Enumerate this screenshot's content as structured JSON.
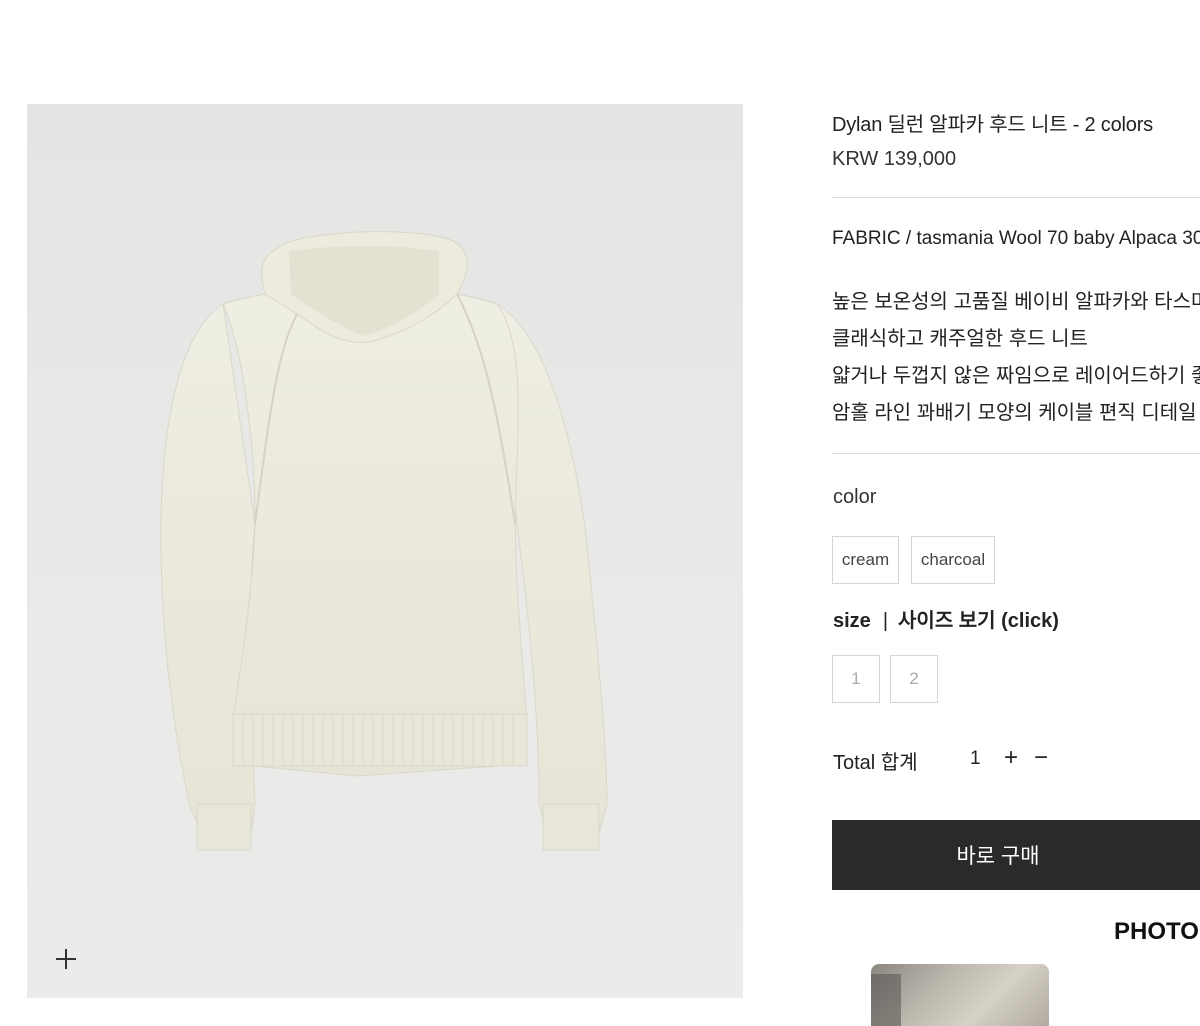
{
  "product": {
    "title": "Dylan 딜런 알파카 후드 니트 - 2 colors",
    "price": "KRW 139,000",
    "fabric": "FABRIC / tasmania Wool 70 baby Alpaca 30",
    "description": [
      "높은 보온성의 고품질 베이비 알파카와 타스마니아 울",
      "클래식하고 캐주얼한 후드 니트",
      "얇거나 두껍지 않은 짜임으로 레이어드하기 좋은",
      "암홀 라인 꽈배기 모양의 케이블 편직 디테일"
    ],
    "image_icon": "zoom-plus-icon"
  },
  "options": {
    "color_label": "color",
    "colors": [
      "cream",
      "charcoal"
    ],
    "size_label": "size",
    "size_separator": "|",
    "size_guide_link": "사이즈 보기 (click)",
    "sizes": [
      "1",
      "2"
    ]
  },
  "quantity": {
    "label": "Total 합계",
    "value": "1",
    "plus": "+",
    "minus": "−"
  },
  "buy_button": "바로 구매",
  "reviews": {
    "heading": "PHOTO"
  },
  "colors": {
    "button_bg": "#2a2a2a",
    "divider": "#dcdcdc",
    "option_border": "#d5d5d5",
    "sweater": "#ecebdd"
  }
}
